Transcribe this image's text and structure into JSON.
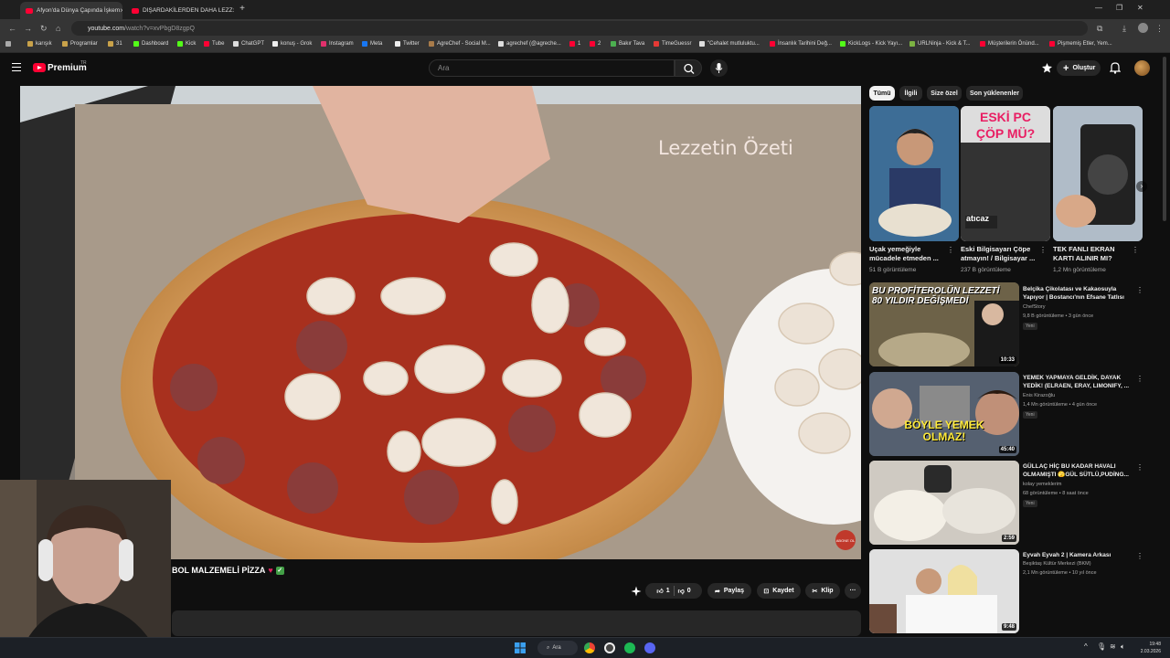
{
  "tabs": [
    {
      "label": "Afyon'da Dünya Çapında İşkem",
      "active": true
    },
    {
      "label": "DIŞARDAKİLERDEN DAHA LEZZ",
      "active": false
    }
  ],
  "address": {
    "host": "youtube.com",
    "path": "/watch?v=xvPbgD8zgpQ"
  },
  "bookmarks": [
    "karışık",
    "Programlar",
    "31",
    "Dashboard",
    "Kick",
    "Tube",
    "ChatGPT",
    "konuş - Grok",
    "Instagram",
    "Meta",
    "Twitter",
    "AgreChef - Social M...",
    "agrechef (@agreche...",
    "1",
    "2",
    "Bakır Tava",
    "TimeGuessr",
    "\"Cehalet mutluluktu...",
    "İnsanlık Tarihini Değ...",
    "KickLogs - Kick Yayı...",
    "URLNinja - Kick & T...",
    "Müşterilerin Önünd...",
    "Pişmemiş Etler, Yem..."
  ],
  "youtube": {
    "brand": "Premium",
    "country": "TR",
    "search_placeholder": "Ara",
    "create_label": "Oluştur"
  },
  "video": {
    "overlay_text": "Lezzetin Özeti",
    "title": "BOL MALZEMELİ PİZZA",
    "watermark": "ABONE OL",
    "likes": "1",
    "dislikes": "0",
    "share_label": "Paylaş",
    "save_label": "Kaydet",
    "clip_label": "Klip",
    "more_label": "···"
  },
  "chips": [
    "Tümü",
    "İlgili",
    "Size özel",
    "Son yüklenenler"
  ],
  "shorts": [
    {
      "title": "Uçak yemeğiyle mücadele etmeden ...",
      "views": "51 B görüntüleme"
    },
    {
      "title": "Eski Bilgisayarı Çöpe atmayın! / Bilgisayar ...",
      "views": "237 B görüntüleme",
      "overlay1": "ESKİ PC",
      "overlay2": "ÇÖP MÜ?",
      "overlay3": "atıcaz"
    },
    {
      "title": "TEK FANLI EKRAN KARTI ALINIR MI?",
      "views": "1,2 Mn görüntüleme"
    }
  ],
  "recs": [
    {
      "title": "Belçika Çikolatası ve Kakaosuyla Yapıyor | Bostancı'nın Efsane Tatlısı",
      "channel": "ChefStory",
      "meta": "9,8 B görüntüleme • 3 gün önce",
      "badge": "Yeni",
      "duration": "10:33",
      "thumb_text": "BU PROFİTEROLÜN LEZZETİ 80 YILDIR DEĞİŞMEDİ"
    },
    {
      "title": "YEMEK YAPMAYA GELDİK, DAYAK YEDİK! (ELRAEN, ERAY, LIMONIFY, ...",
      "channel": "Enis Kirazoğlu",
      "meta": "1,4 Mn görüntüleme • 4 gün önce",
      "badge": "Yeni",
      "duration": "45:40",
      "thumb_text": "BÖYLE YEMEK OLMAZ!"
    },
    {
      "title": "GÜLLAÇ HİÇ BU KADAR HAVALI OLMAMIŞTI 🫣GÜL SÜTLÜ,PUDİNG...",
      "channel": "kolay yemeklerim",
      "meta": "68 görüntüleme • 8 saat önce",
      "badge": "Yeni",
      "duration": "2:59"
    },
    {
      "title": "Eyvah Eyvah 2 | Kamera Arkası",
      "channel": "Beşiktaş Kültür Merkezi (BKM)",
      "meta": "2,1 Mn görüntüleme • 10 yıl önce",
      "duration": "9:48"
    }
  ],
  "taskbar": {
    "search_label": "Ara",
    "time": "19:48",
    "date": "2.03.2026"
  }
}
